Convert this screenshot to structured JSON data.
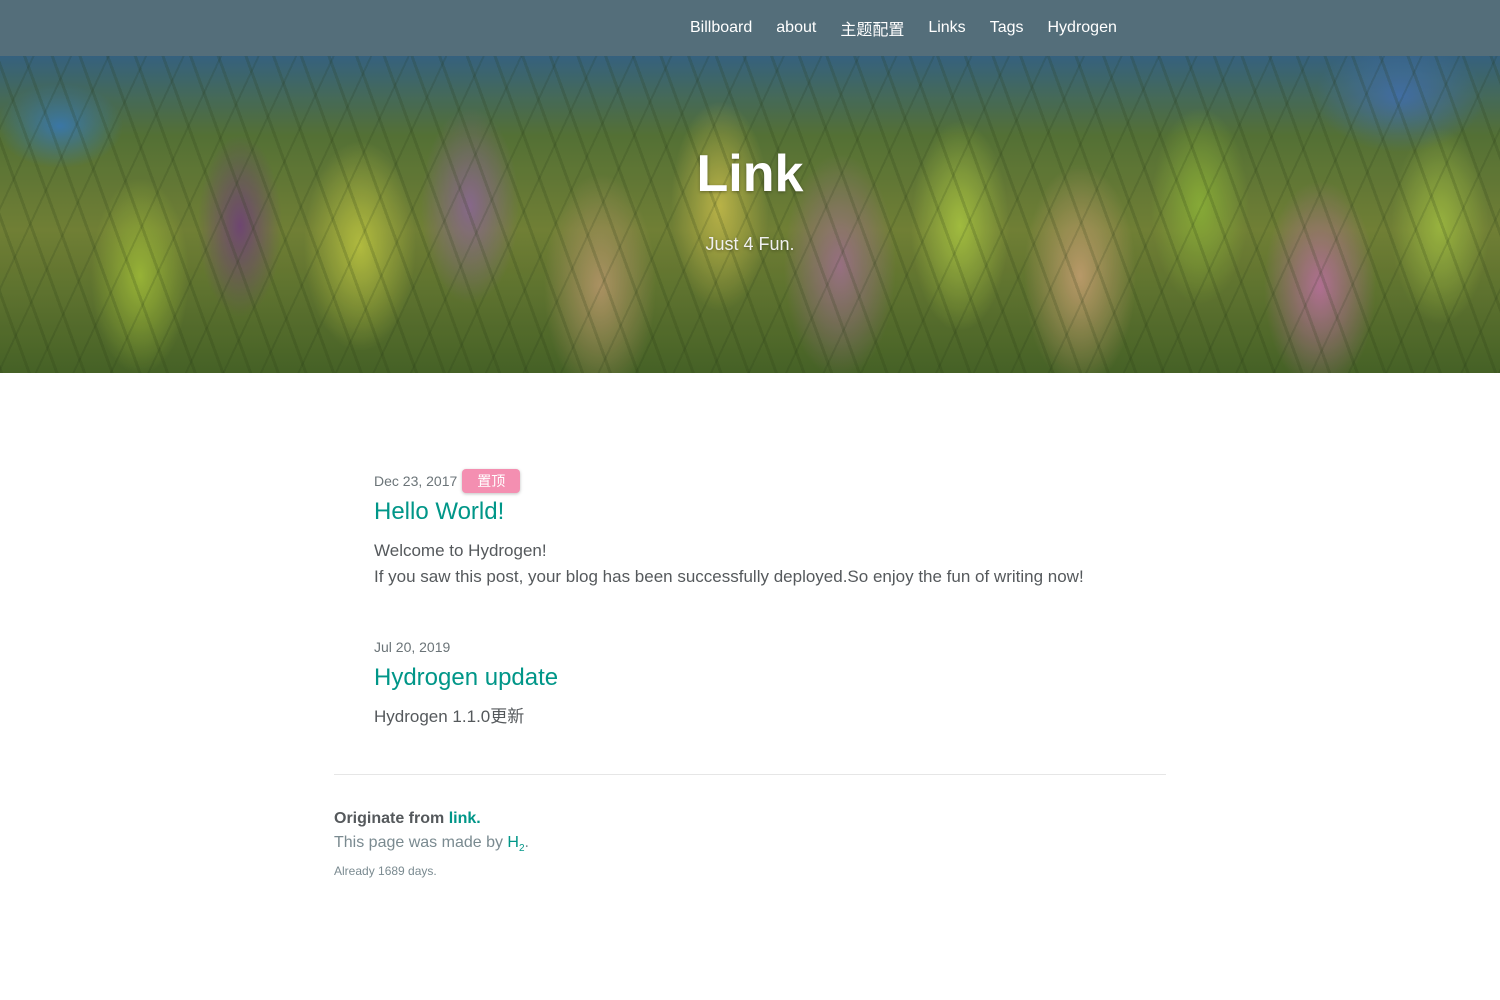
{
  "nav": {
    "items": [
      {
        "label": "Billboard"
      },
      {
        "label": "about"
      },
      {
        "label": "主题配置"
      },
      {
        "label": "Links"
      },
      {
        "label": "Tags"
      },
      {
        "label": "Hydrogen"
      }
    ]
  },
  "hero": {
    "title": "Link",
    "subtitle": "Just 4 Fun."
  },
  "posts": [
    {
      "date": "Dec 23, 2017",
      "badge": "置顶",
      "title": "Hello World!",
      "excerpt_line1": "Welcome to Hydrogen!",
      "excerpt_line2": "If you saw this post, your blog has been successfully deployed.So enjoy the fun of writing now!"
    },
    {
      "date": "Jul 20, 2019",
      "title": "Hydrogen update",
      "excerpt_line1": "Hydrogen 1.1.0更新"
    }
  ],
  "footer": {
    "originate_prefix": "Originate from ",
    "originate_link": "link",
    "originate_suffix": ".",
    "made_by_prefix": "This page was made by ",
    "made_by_link_main": "H",
    "made_by_link_sub": "2",
    "made_by_suffix": ".",
    "days_text": "Already 1689 days."
  },
  "colors": {
    "navbar": "#546e7a",
    "accent": "#009688",
    "badge": "#f48fb1"
  }
}
